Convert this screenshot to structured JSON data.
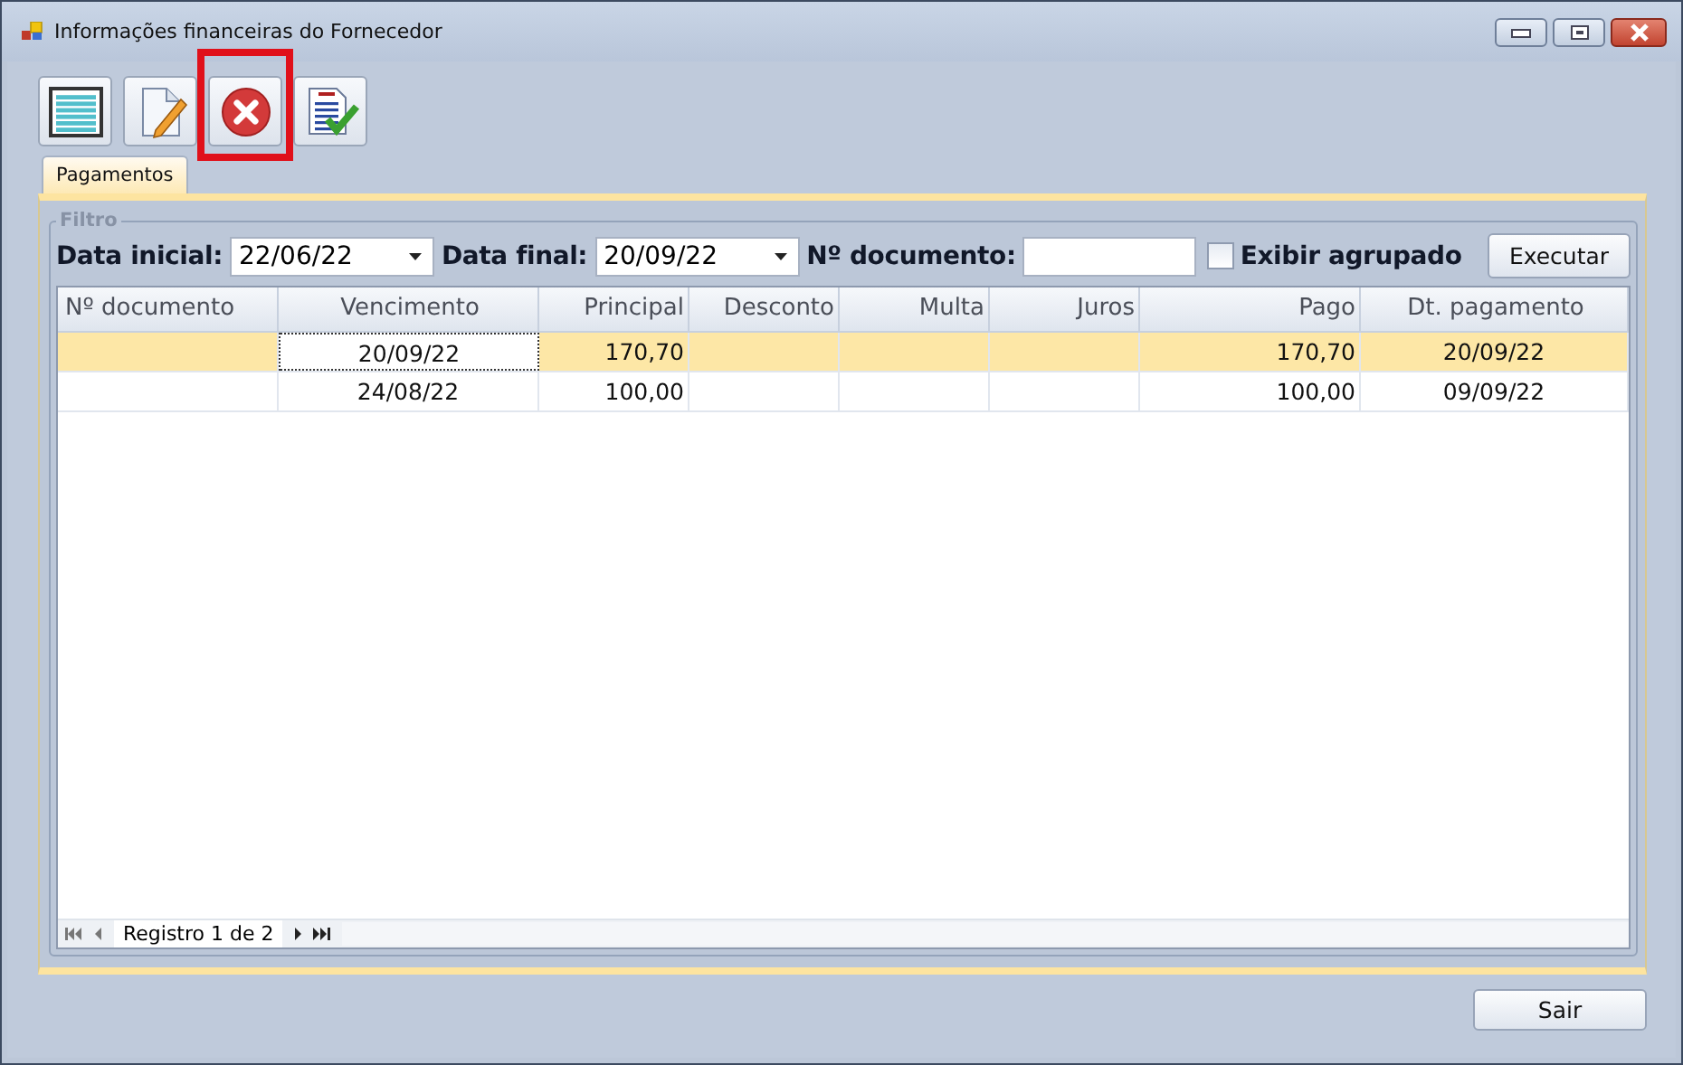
{
  "window": {
    "title": "Informações financeiras do Fornecedor"
  },
  "toolbar": [
    {
      "kind": "list",
      "highlighted": false
    },
    {
      "kind": "edit",
      "highlighted": false
    },
    {
      "kind": "delete",
      "highlighted": true
    },
    {
      "kind": "report",
      "highlighted": false
    }
  ],
  "tabs": [
    {
      "label": "Pagamentos",
      "selected": true
    }
  ],
  "filter": {
    "title": "Filtro",
    "date_start": {
      "label": "Data inicial:",
      "value": "22/06/22"
    },
    "date_end": {
      "label": "Data final:",
      "value": "20/09/22"
    },
    "document": {
      "label": "Nº documento:"
    },
    "grouped": {
      "label": "Exibir agrupado",
      "checked": false
    },
    "run_button": "Executar"
  },
  "table": {
    "columns": [
      "Nº documento",
      "Vencimento",
      "Principal",
      "Desconto",
      "Multa",
      "Juros",
      "Pago",
      "Dt. pagamento"
    ],
    "rows": [
      {
        "selected": true,
        "cells": [
          {
            "focused": false
          },
          {
            "text": "20/09/22",
            "focused": true
          },
          {
            "text": "170,70",
            "focused": false
          },
          {
            "focused": false
          },
          {
            "focused": false
          },
          {
            "focused": false
          },
          {
            "text": "170,70",
            "focused": false
          },
          {
            "text": "20/09/22",
            "focused": false
          }
        ]
      },
      {
        "selected": false,
        "cells": [
          {
            "focused": false
          },
          {
            "text": "24/08/22",
            "focused": false
          },
          {
            "text": "100,00",
            "focused": false
          },
          {
            "focused": false
          },
          {
            "focused": false
          },
          {
            "focused": false
          },
          {
            "text": "100,00",
            "focused": false
          },
          {
            "text": "09/09/22",
            "focused": false
          }
        ]
      }
    ],
    "navigator": "Registro 1 de 2"
  },
  "close_button": "Sair"
}
